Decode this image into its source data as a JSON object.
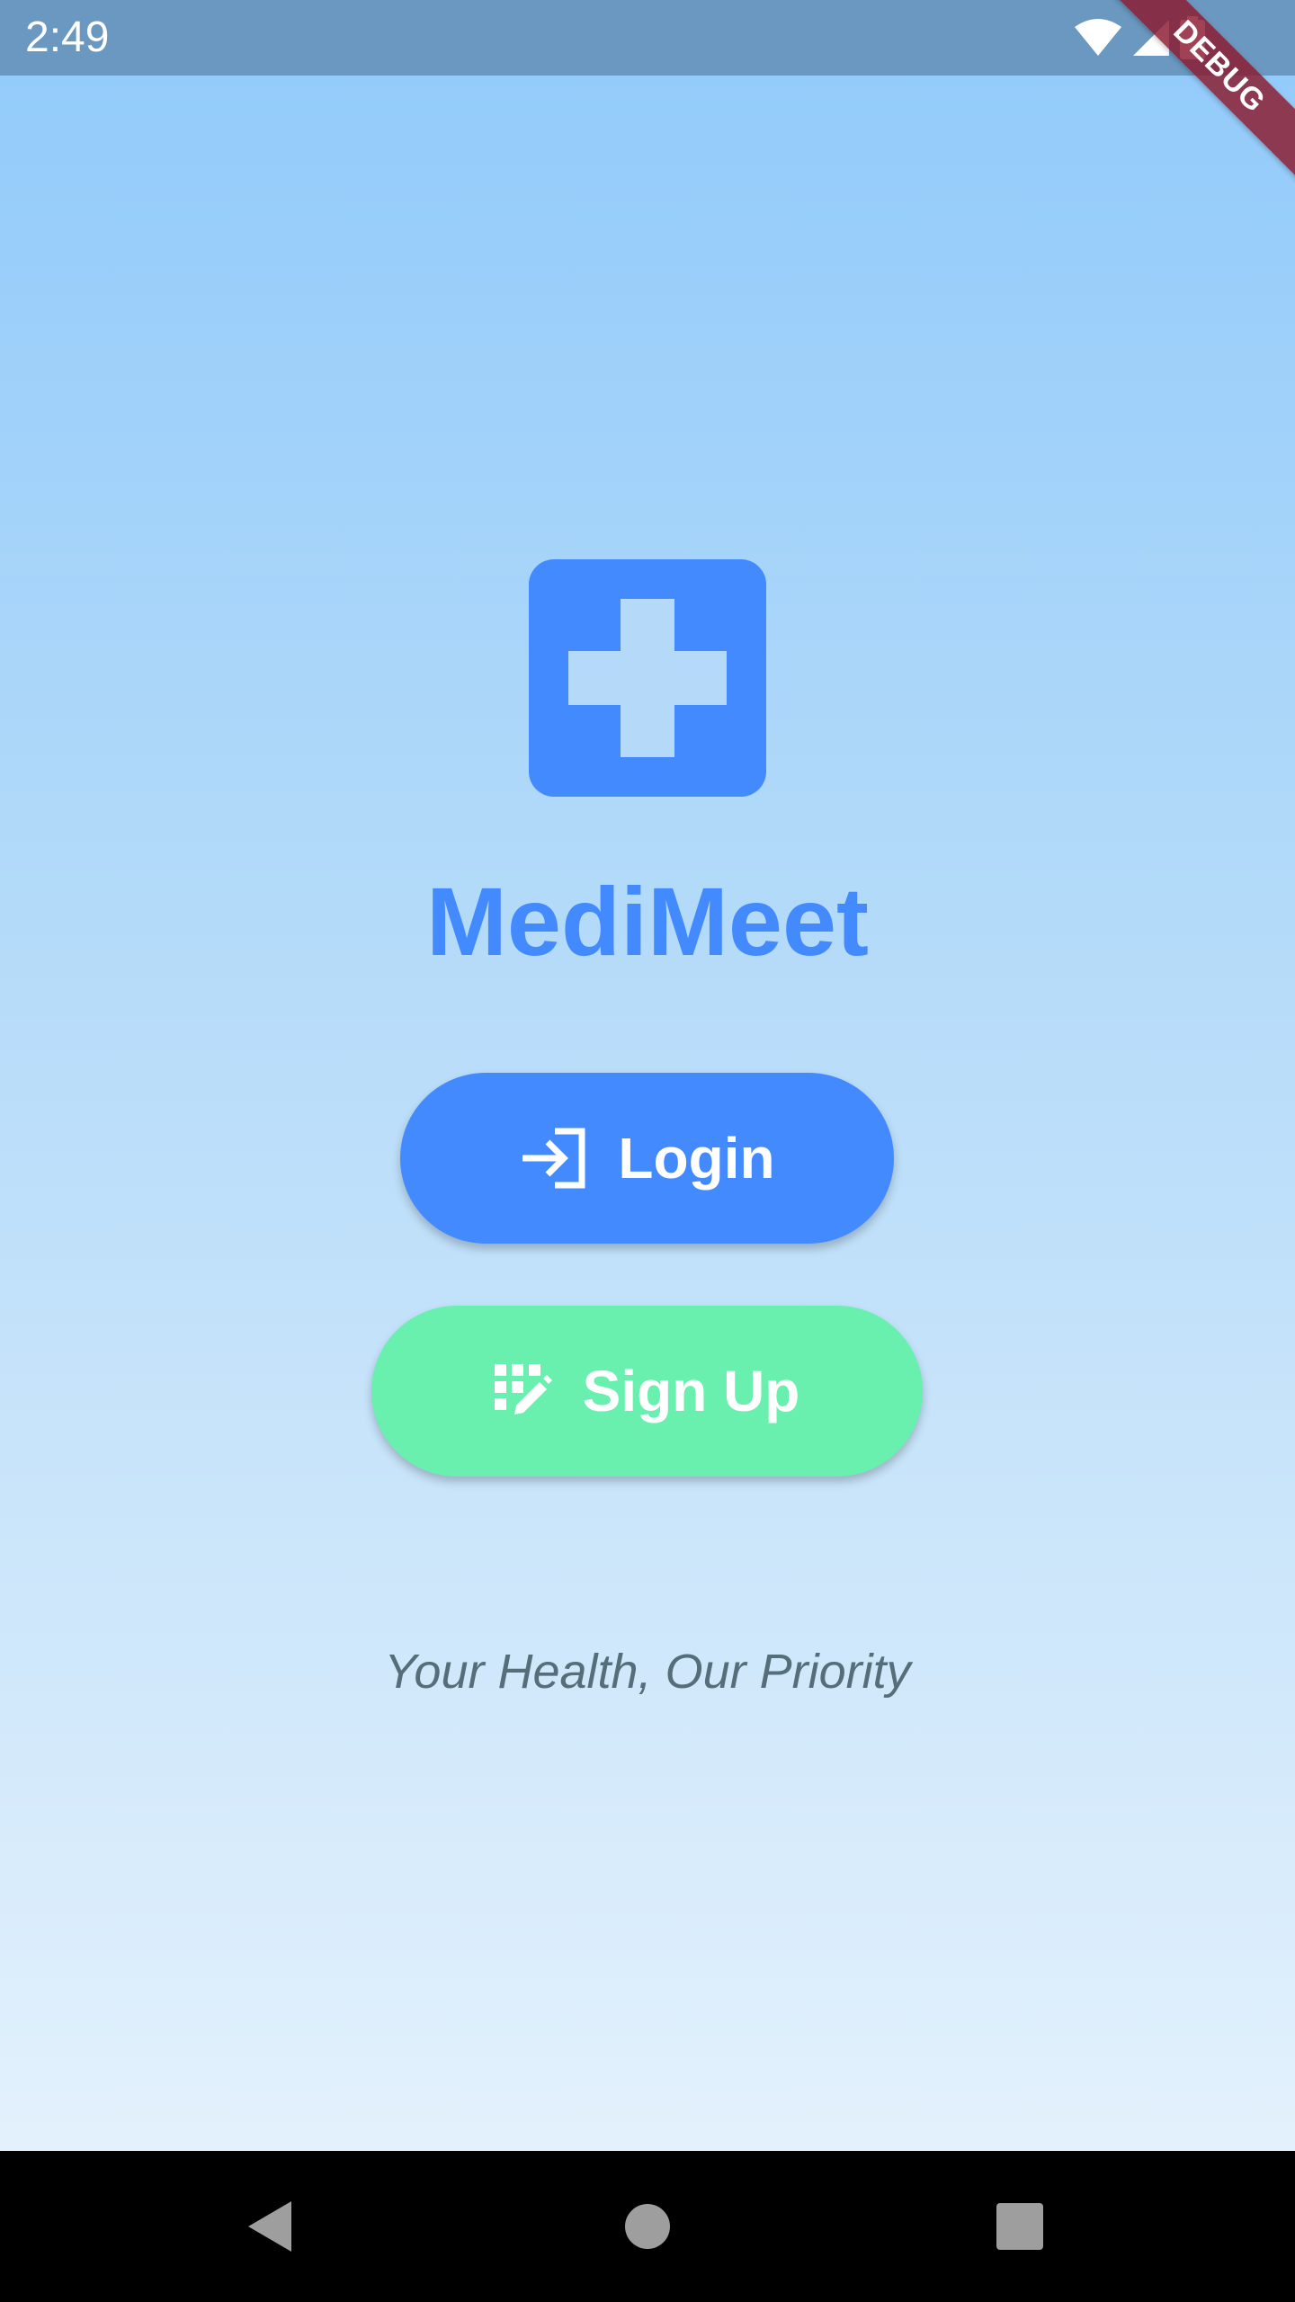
{
  "status_bar": {
    "time": "2:49",
    "icons": [
      "wifi-icon",
      "signal-icon",
      "battery-icon"
    ]
  },
  "debug_banner": {
    "label": "DEBUG"
  },
  "app": {
    "title": "MediMeet",
    "logo_icon": "medical-cross-icon",
    "tagline": "Your Health, Our Priority"
  },
  "buttons": {
    "login": {
      "label": "Login",
      "icon": "login-icon"
    },
    "signup": {
      "label": "Sign Up",
      "icon": "app-registration-icon"
    }
  },
  "nav_bar": {
    "icons": [
      "back-icon",
      "home-icon",
      "recents-icon"
    ]
  },
  "colors": {
    "primary": "#448aff",
    "accent": "#69f0ae",
    "tagline": "#546e7a",
    "status_bar": "#6b98c0",
    "gradient_top": "#93cbfa",
    "gradient_bottom": "#e3f1fc"
  }
}
